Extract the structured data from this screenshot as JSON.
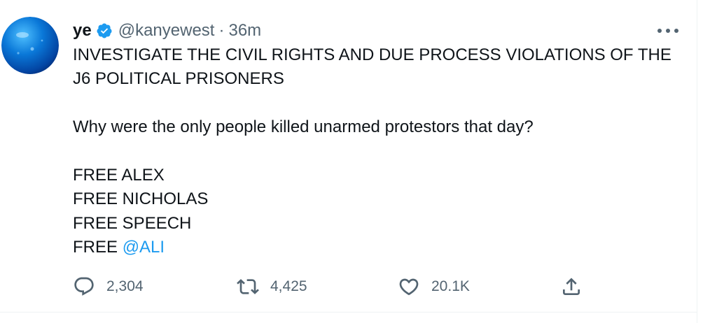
{
  "tweet": {
    "author_name": "ye",
    "handle": "@kanyewest",
    "separator": "·",
    "time": "36m",
    "lines": {
      "l1": "INVESTIGATE THE CIVIL RIGHTS AND DUE PROCESS VIOLATIONS OF THE",
      "l2": "J6 POLITICAL PRISONERS",
      "l3": "Why were the only people killed unarmed protestors that day?",
      "l4": "FREE ALEX",
      "l5": "FREE NICHOLAS",
      "l6": "FREE SPEECH",
      "l7_prefix": "FREE",
      "l7_mention": "@ALI"
    }
  },
  "actions": {
    "replies": "2,304",
    "retweets": "4,425",
    "likes": "20.1K"
  },
  "icons": {
    "verified": "verified-badge-icon",
    "more": "more-options-icon",
    "reply": "reply-icon",
    "retweet": "retweet-icon",
    "like": "heart-icon",
    "share": "share-icon"
  },
  "colors": {
    "accent": "#1d9bf0",
    "text": "#0f1419",
    "secondary": "#536471",
    "border": "#eff3f4"
  }
}
